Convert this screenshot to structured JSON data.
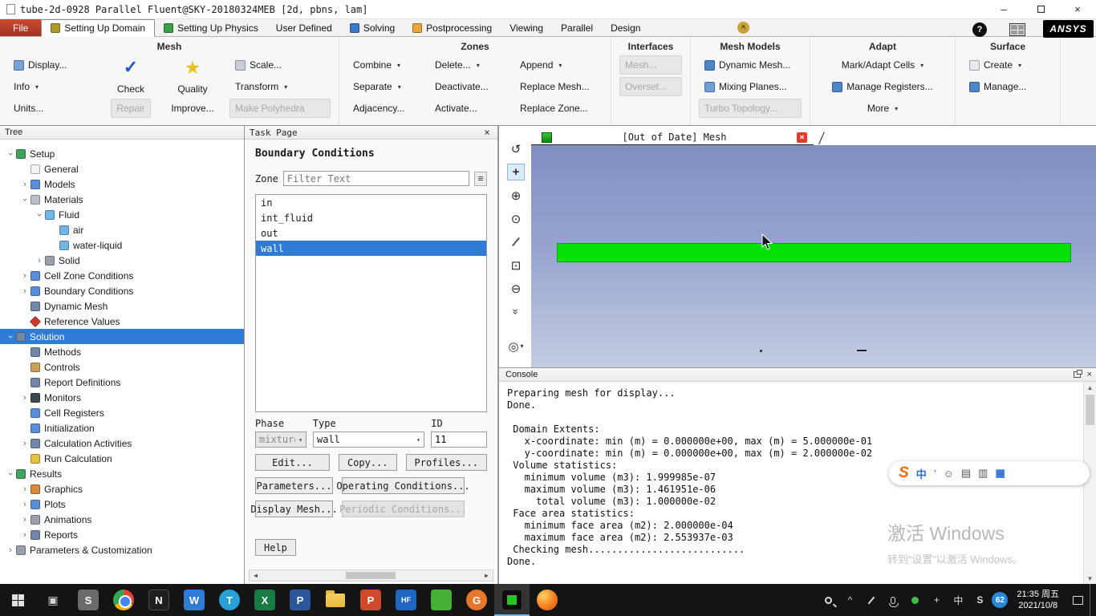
{
  "titlebar": {
    "title": "tube-2d-0928 Parallel Fluent@SKY-20180324MEB  [2d, pbns, lam]"
  },
  "tabs": [
    "File",
    "Setting Up Domain",
    "Setting Up Physics",
    "User Defined",
    "Solving",
    "Postprocessing",
    "Viewing",
    "Parallel",
    "Design"
  ],
  "brand": {
    "ansys": "ANSYS",
    "help": "?"
  },
  "ribbon": {
    "titles": [
      "Mesh",
      "Zones",
      "Interfaces",
      "Mesh Models",
      "Adapt",
      "Surface"
    ],
    "mesh": {
      "display": "Display...",
      "check": "Check",
      "quality": "Quality",
      "scale": "Scale...",
      "info": "Info",
      "transform": "Transform",
      "units": "Units...",
      "repair": "Repair",
      "improve": "Improve...",
      "make_polyhedra": "Make Polyhedra"
    },
    "zones": {
      "combine": "Combine",
      "delete": "Delete...",
      "append": "Append",
      "separate": "Separate",
      "deactivate": "Deactivate...",
      "replace_mesh": "Replace Mesh...",
      "adjacency": "Adjacency...",
      "activate": "Activate...",
      "replace_zone": "Replace Zone..."
    },
    "interfaces": {
      "mesh": "Mesh...",
      "overset": "Overset..."
    },
    "mesh_models": {
      "dynamic_mesh": "Dynamic Mesh...",
      "mixing_planes": "Mixing Planes...",
      "turbo_topology": "Turbo Topology..."
    },
    "adapt": {
      "mark_adapt_cells": "Mark/Adapt Cells",
      "manage_registers": "Manage Registers...",
      "more": "More"
    },
    "surface": {
      "create": "Create",
      "manage": "Manage..."
    }
  },
  "tree": {
    "header": "Tree",
    "items": [
      {
        "label": "Setup"
      },
      {
        "label": "General"
      },
      {
        "label": "Models"
      },
      {
        "label": "Materials"
      },
      {
        "label": "Fluid"
      },
      {
        "label": "air"
      },
      {
        "label": "water-liquid"
      },
      {
        "label": "Solid"
      },
      {
        "label": "Cell Zone Conditions"
      },
      {
        "label": "Boundary Conditions"
      },
      {
        "label": "Dynamic Mesh"
      },
      {
        "label": "Reference Values"
      },
      {
        "label": "Solution"
      },
      {
        "label": "Methods"
      },
      {
        "label": "Controls"
      },
      {
        "label": "Report Definitions"
      },
      {
        "label": "Monitors"
      },
      {
        "label": "Cell Registers"
      },
      {
        "label": "Initialization"
      },
      {
        "label": "Calculation Activities"
      },
      {
        "label": "Run Calculation"
      },
      {
        "label": "Results"
      },
      {
        "label": "Graphics"
      },
      {
        "label": "Plots"
      },
      {
        "label": "Animations"
      },
      {
        "label": "Reports"
      },
      {
        "label": "Parameters & Customization"
      }
    ]
  },
  "task_page": {
    "header": "Task Page",
    "title": "Boundary Conditions",
    "zone_label": "Zone",
    "filter_placeholder": "Filter Text",
    "zones": [
      "in",
      "int_fluid",
      "out",
      "wall"
    ],
    "phase_label": "Phase",
    "type_label": "Type",
    "id_label": "ID",
    "phase_value": "mixture",
    "type_value": "wall",
    "id_value": "11",
    "buttons": {
      "edit": "Edit...",
      "copy": "Copy...",
      "profiles": "Profiles...",
      "parameters": "Parameters...",
      "operating": "Operating Conditions...",
      "display_mesh": "Display Mesh...",
      "periodic": "Periodic Conditions...",
      "help": "Help"
    }
  },
  "graphics": {
    "title": "[Out of Date] Mesh"
  },
  "console": {
    "title": "Console",
    "text": "Preparing mesh for display...\nDone.\n\n Domain Extents:\n   x-coordinate: min (m) = 0.000000e+00, max (m) = 5.000000e-01\n   y-coordinate: min (m) = 0.000000e+00, max (m) = 2.000000e-02\n Volume statistics:\n   minimum volume (m3): 1.999985e-07\n   maximum volume (m3): 1.461951e-06\n     total volume (m3): 1.000000e-02\n Face area statistics:\n   minimum face area (m2): 2.000000e-04\n   maximum face area (m2): 2.553937e-03\n Checking mesh...........................\nDone."
  },
  "watermark": {
    "line1": "激活 Windows",
    "line2": "转到“设置”以激活 Windows。"
  },
  "ime_bar": {
    "icons": [
      "中",
      "’",
      "☺",
      "▤",
      "▥",
      "▦"
    ]
  },
  "taskbar": {
    "items": [
      {
        "name": "start",
        "glyph": ""
      },
      {
        "name": "task-view",
        "glyph": "▣"
      },
      {
        "name": "sogou",
        "glyph": "S"
      },
      {
        "name": "chrome",
        "glyph": ""
      },
      {
        "name": "notes-app",
        "glyph": "N"
      },
      {
        "name": "wechat-work",
        "glyph": "W"
      },
      {
        "name": "telegram",
        "glyph": "T"
      },
      {
        "name": "excel",
        "glyph": "X"
      },
      {
        "name": "pdf-app",
        "glyph": "P"
      },
      {
        "name": "file-explorer",
        "glyph": ""
      },
      {
        "name": "powerpoint",
        "glyph": "P"
      },
      {
        "name": "foxit",
        "glyph": "HF"
      },
      {
        "name": "wechat",
        "glyph": ""
      },
      {
        "name": "g-app",
        "glyph": "G"
      },
      {
        "name": "fluent",
        "glyph": ""
      },
      {
        "name": "firefox",
        "glyph": ""
      }
    ],
    "tray": {
      "ime": "中",
      "sogou": "S",
      "badge": "62",
      "time": "21:35 周五",
      "date": "2021/10/8"
    }
  }
}
